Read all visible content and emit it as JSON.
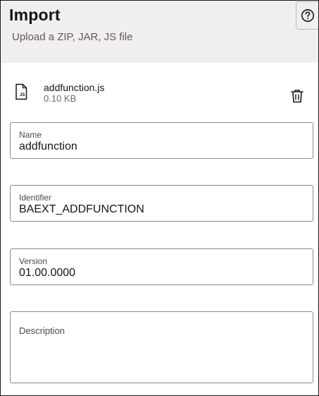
{
  "dialog": {
    "title": "Import",
    "subtitle": "Upload a ZIP, JAR, JS file",
    "help_icon": "question-circle-icon"
  },
  "file": {
    "icon": "js-file-icon",
    "icon_text": "JS",
    "name": "addfunction.js",
    "size": "0.10 KB",
    "delete_icon": "trash-icon"
  },
  "fields": {
    "name": {
      "label": "Name",
      "value": "addfunction"
    },
    "identifier": {
      "label": "Identifier",
      "value": "BAEXT_ADDFUNCTION"
    },
    "version": {
      "label": "Version",
      "value": "01.00.0000"
    },
    "description": {
      "label": "Description",
      "value": ""
    }
  },
  "colors": {
    "header_background": "#f1efed",
    "border": "#8c8a87",
    "text": "#161513",
    "muted_text": "#6f6b66"
  }
}
